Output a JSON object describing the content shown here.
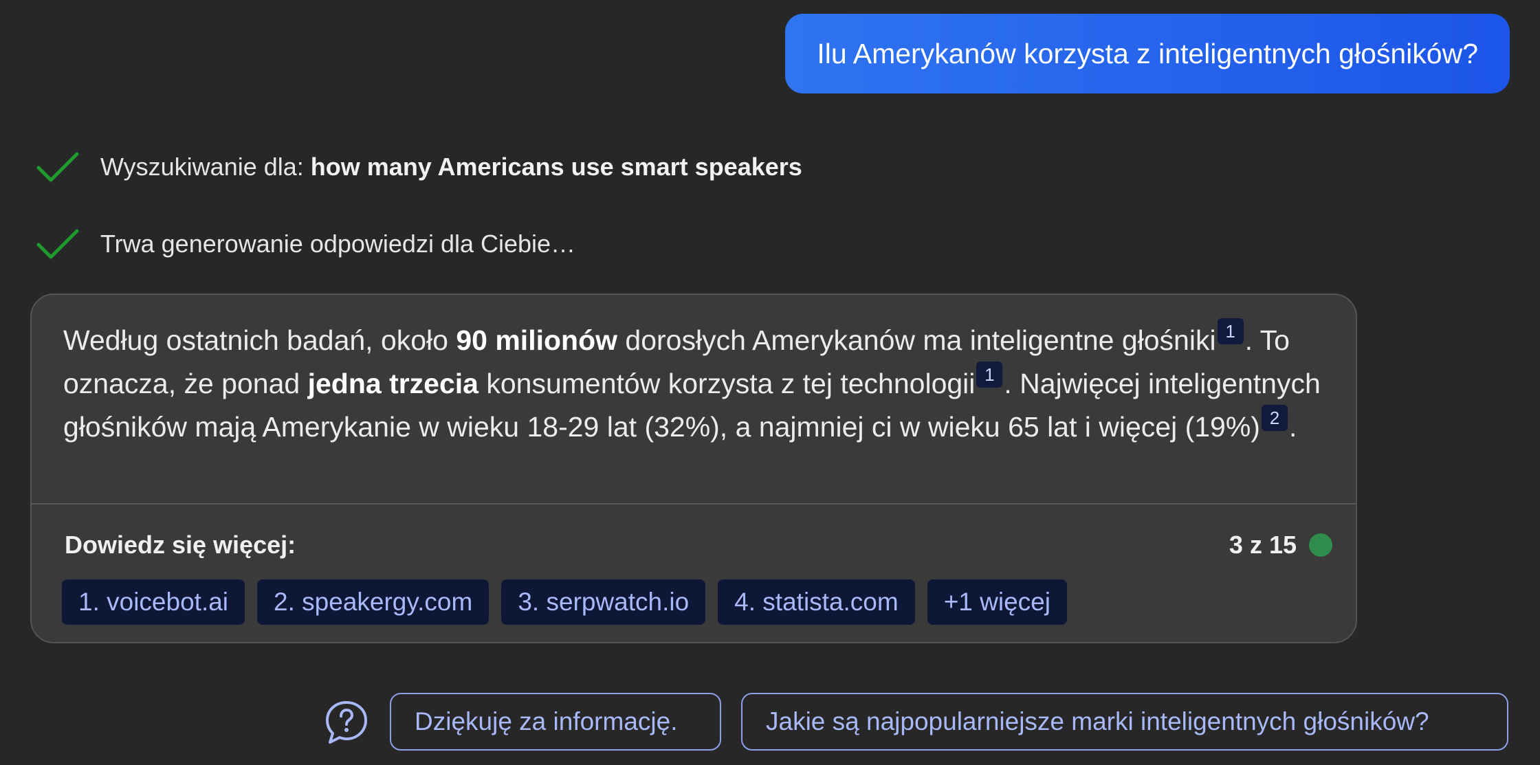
{
  "user_message": "Ilu Amerykanów korzysta z inteligentnych głośników?",
  "status": {
    "search_prefix": "Wyszukiwanie dla: ",
    "search_query": "how many Americans use smart speakers",
    "generating": "Trwa generowanie odpowiedzi dla Ciebie…"
  },
  "answer": {
    "p1": "Według ostatnich badań, około ",
    "b1": "90 milionów",
    "p2": " dorosłych Amerykanów ma inteligentne głośniki",
    "c1": "1",
    "p3": ". To oznacza, że ponad ",
    "b2": "jedna trzecia",
    "p4": " konsumentów korzysta z tej technologii",
    "c2": "1",
    "p5": ". Najwięcej inteligentnych głośników mają Amerykanie w wieku 18-29 lat (32%), a najmniej ci w wieku 65 lat i więcej (19%)",
    "c3": "2",
    "p6": "."
  },
  "learn_more": {
    "label": "Dowiedz się więcej:",
    "count": "3 z 15",
    "status_color": "#2f8c4c",
    "sources": [
      "1. voicebot.ai",
      "2. speakergy.com",
      "3. serpwatch.io",
      "4. statista.com",
      "+1 więcej"
    ]
  },
  "suggestions": {
    "icon": "help-bubble-icon",
    "items": [
      "Dziękuję za informację.",
      "Jakie są najpopularniejsze marki inteligentnych głośników?"
    ]
  },
  "colors": {
    "background": "#272727",
    "user_bubble": "#2563eb",
    "check": "#1f9a2c",
    "link": "#a9b8f8"
  }
}
